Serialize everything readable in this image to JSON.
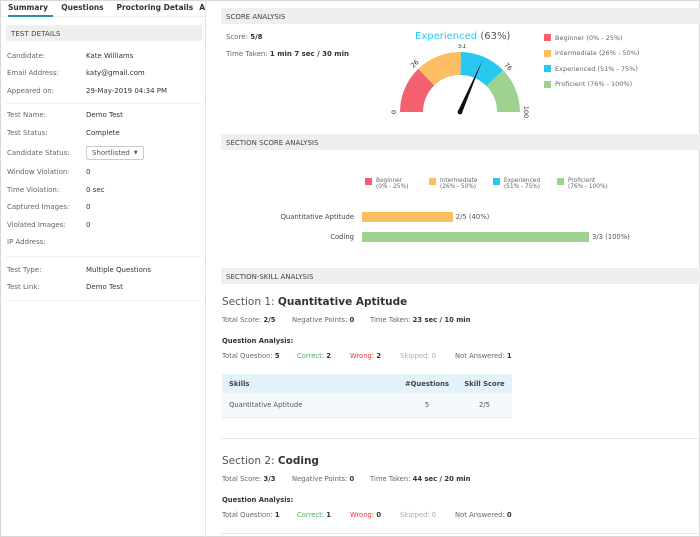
{
  "tabs": [
    {
      "label": "Summary",
      "active": true
    },
    {
      "label": "Questions",
      "active": false
    },
    {
      "label": "Proctoring Details",
      "active": false
    },
    {
      "label": "A",
      "active": false
    }
  ],
  "test_details": {
    "title": "TEST DETAILS",
    "group1": [
      {
        "label": "Candidate:",
        "value": "Kate Williams"
      },
      {
        "label": "Email Address:",
        "value": "katy@gmail.com"
      },
      {
        "label": "Appeared on:",
        "value": "29-May-2019 04:34 PM"
      }
    ],
    "group2": [
      {
        "label": "Test Name:",
        "value": "Demo Test"
      },
      {
        "label": "Test Status:",
        "value": "Complete"
      },
      {
        "label": "Candidate Status:",
        "value": "Shortlisted",
        "type": "select"
      },
      {
        "label": "Window Violation:",
        "value": "0"
      },
      {
        "label": "Time Violation:",
        "value": "0 sec"
      },
      {
        "label": "Captured Images:",
        "value": "0"
      },
      {
        "label": "Violated Images:",
        "value": "0"
      },
      {
        "label": "IP Address:",
        "value": ""
      }
    ],
    "group3": [
      {
        "label": "Test Type:",
        "value": "Multiple Questions"
      },
      {
        "label": "Test Link:",
        "value": "Demo Test"
      }
    ]
  },
  "score_analysis": {
    "title": "SCORE ANALYSIS",
    "score_label": "Score:",
    "score_value": "5/8",
    "time_label": "Time Taken:",
    "time_value": "1 min 7 sec / 30 min",
    "gauge_title_level": "Experienced",
    "gauge_title_pct": "(63%)",
    "gauge_value": 63,
    "gauge_ticks": [
      "0",
      "26",
      "51",
      "76",
      "100"
    ],
    "bands": [
      {
        "name": "Beginner",
        "from": 0,
        "to": 25,
        "color": "#f4606f"
      },
      {
        "name": "Intermediate",
        "from": 26,
        "to": 50,
        "color": "#fdbe63"
      },
      {
        "name": "Experienced",
        "from": 51,
        "to": 75,
        "color": "#28c8f0"
      },
      {
        "name": "Proficient",
        "from": 76,
        "to": 100,
        "color": "#9ed290"
      }
    ],
    "legend": [
      "Beginner (0% - 25%)",
      "Intermediate (26% - 50%)",
      "Experienced (51% - 75%)",
      "Proficient (76% - 100%)"
    ]
  },
  "section_score": {
    "title": "SECTION SCORE ANALYSIS",
    "legend": [
      {
        "name": "Beginner",
        "range": "(0% - 25%)"
      },
      {
        "name": "Intermediate",
        "range": "(26% - 50%)"
      },
      {
        "name": "Experienced",
        "range": "(51% - 75%)"
      },
      {
        "name": "Proficient",
        "range": "(76% - 100%)"
      }
    ],
    "bars": [
      {
        "label": "Quantitative Aptitude",
        "value_label": "2/5 (40%)",
        "percent": 40
      },
      {
        "label": "Coding",
        "value_label": "3/3 (100%)",
        "percent": 100
      }
    ]
  },
  "section_skill": {
    "title": "SECTION-SKILL ANALYSIS",
    "sections": [
      {
        "prefix": "Section 1:",
        "name": "Quantitative Aptitude",
        "total_score_label": "Total Score:",
        "total_score": "2/5",
        "negative_label": "Negative Points:",
        "negative": "0",
        "time_label": "Time Taken:",
        "time": "23 sec / 10 min",
        "qa_title": "Question Analysis:",
        "total_q_label": "Total Question:",
        "total_q": "5",
        "correct_label": "Correct:",
        "correct": "2",
        "wrong_label": "Wrong:",
        "wrong": "2",
        "skipped_label": "Skipped:",
        "skipped": "0",
        "na_label": "Not Answered:",
        "na": "1",
        "table": {
          "headers": [
            "Skills",
            "#Questions",
            "Skill Score"
          ],
          "rows": [
            [
              "Quantitative Aptitude",
              "5",
              "2/5"
            ]
          ]
        }
      },
      {
        "prefix": "Section 2:",
        "name": "Coding",
        "total_score_label": "Total Score:",
        "total_score": "3/3",
        "negative_label": "Negative Points:",
        "negative": "0",
        "time_label": "Time Taken:",
        "time": "44 sec / 20 min",
        "qa_title": "Question Analysis:",
        "total_q_label": "Total Question:",
        "total_q": "1",
        "correct_label": "Correct:",
        "correct": "1",
        "wrong_label": "Wrong:",
        "wrong": "0",
        "skipped_label": "Skipped:",
        "skipped": "0",
        "na_label": "Not Answered:",
        "na": "0"
      }
    ]
  }
}
